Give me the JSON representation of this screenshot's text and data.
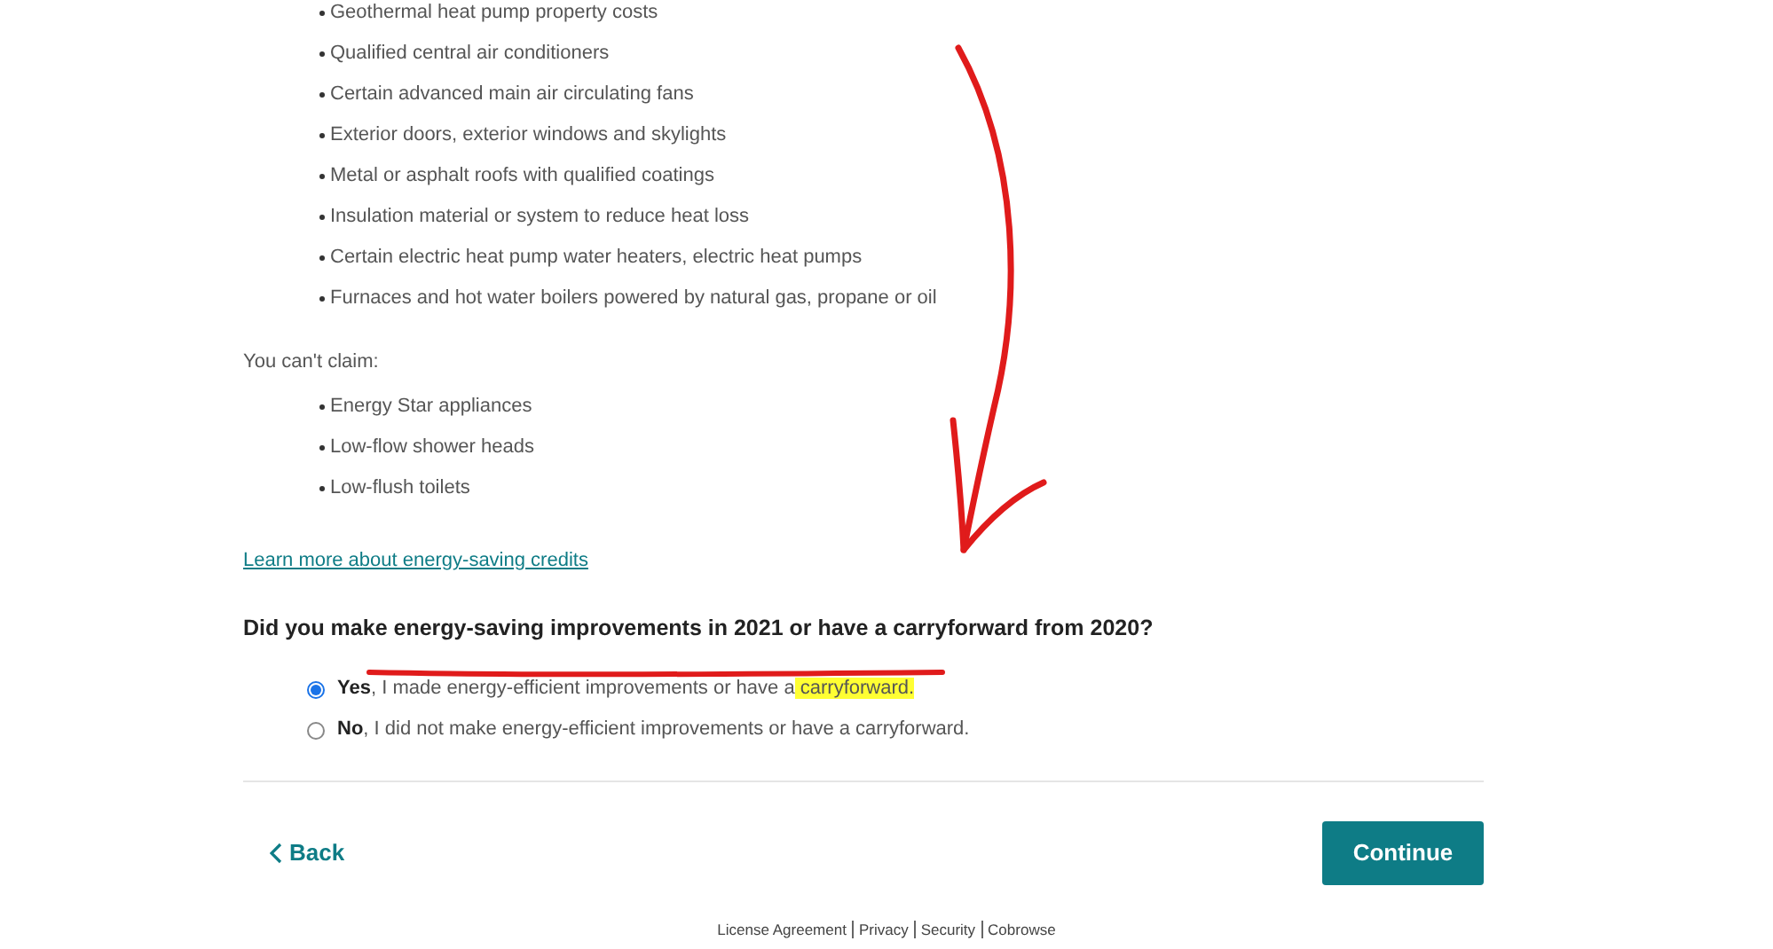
{
  "can_claim": [
    "Geothermal heat pump property costs",
    "Qualified central air conditioners",
    "Certain advanced main air circulating fans",
    "Exterior doors, exterior windows and skylights",
    "Metal or asphalt roofs with qualified coatings",
    "Insulation material or system to reduce heat loss",
    "Certain electric heat pump water heaters, electric heat pumps",
    "Furnaces and hot water boilers powered by natural gas, propane or oil"
  ],
  "cant_claim_heading": "You can't claim:",
  "cant_claim": [
    "Energy Star appliances",
    "Low-flow shower heads",
    "Low-flush toilets"
  ],
  "learn_more_link": "Learn more about energy-saving credits",
  "question": "Did you make energy-saving improvements in 2021 or have a carryforward from 2020?",
  "options": [
    {
      "lead": "Yes",
      "text": ", I made energy-efficient improvements or have a",
      "highlight": " carryforward.",
      "selected": true
    },
    {
      "lead": "No",
      "text": ", I did not make energy-efficient improvements or have a carryforward.",
      "selected": false
    }
  ],
  "back_button": "Back",
  "continue_button": "Continue",
  "footer_links": [
    "License Agreement",
    "Privacy",
    "Security",
    "Cobrowse"
  ]
}
